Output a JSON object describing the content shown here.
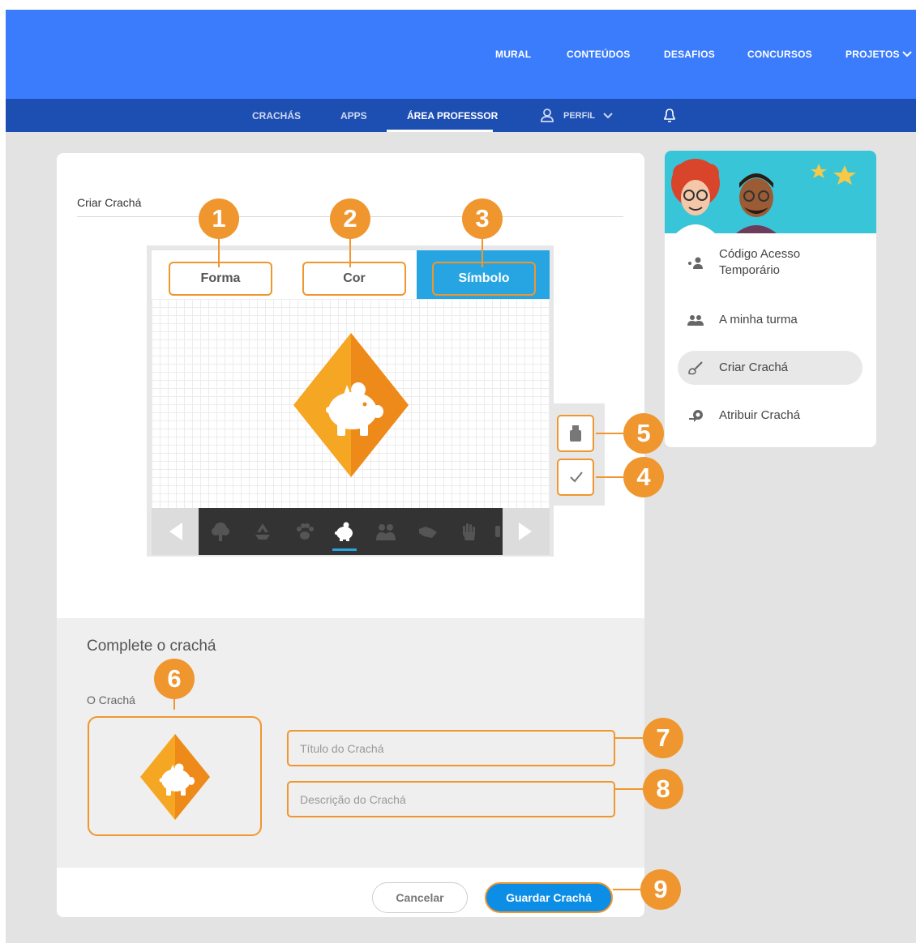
{
  "top_nav": {
    "items": [
      "MURAL",
      "CONTEÚDOS",
      "DESAFIOS",
      "CONCURSOS",
      "PROJETOS"
    ]
  },
  "sub_nav": {
    "crachas": "CRACHÁS",
    "apps": "APPS",
    "area_professor": "ÁREA PROFESSOR",
    "perfil": "PERFIL"
  },
  "editor": {
    "card_title": "Criar Crachá",
    "tabs": {
      "forma": "Forma",
      "cor": "Cor",
      "simbolo": "Símbolo"
    },
    "symbols": [
      "tree-icon",
      "recycle-icon",
      "paw-icon",
      "piggy-bank-icon",
      "people-icon",
      "handshake-icon",
      "hand-icon"
    ],
    "selected_symbol": "piggy-bank-icon",
    "badge_shape": "diamond",
    "badge_color": "#f5a623"
  },
  "complete": {
    "heading": "Complete o crachá",
    "badge_label": "O Crachá",
    "title_placeholder": "Título do Crachá",
    "description_placeholder": "Descrição do Crachá"
  },
  "actions": {
    "cancel": "Cancelar",
    "save": "Guardar Crachá"
  },
  "sidebar": {
    "items": [
      {
        "label": "Código Acesso Temporário",
        "icon": "code-access-icon"
      },
      {
        "label": "A minha turma",
        "icon": "group-icon"
      },
      {
        "label": "Criar Crachá",
        "icon": "brush-icon",
        "active": true
      },
      {
        "label": "Atribuir Crachá",
        "icon": "assign-badge-icon"
      }
    ]
  },
  "callouts": [
    "1",
    "2",
    "3",
    "4",
    "5",
    "6",
    "7",
    "8",
    "9"
  ],
  "colors": {
    "accent": "#f0962e",
    "topnav": "#3b7cfc",
    "subnav": "#1d4fb2",
    "tab_active": "#27a5e3",
    "primary_button": "#0c8de6"
  }
}
